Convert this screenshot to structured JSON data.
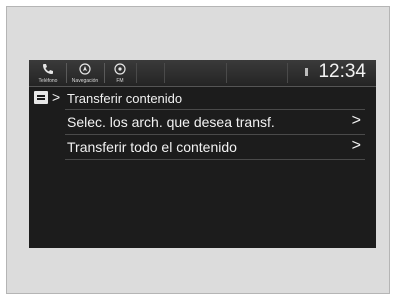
{
  "topbar": {
    "tabs": [
      {
        "label": "Teléfono",
        "icon": "phone-icon"
      },
      {
        "label": "Navegación",
        "icon": "navigation-icon"
      },
      {
        "label": "FM",
        "icon": "radio-icon"
      }
    ],
    "clock": "12:34"
  },
  "breadcrumb": {
    "home_icon": "menu-home-icon",
    "title": "Transferir contenido"
  },
  "list": {
    "items": [
      {
        "label": "Selec. los arch. que desea transf.",
        "icon": "chevron-right-icon"
      },
      {
        "label": "Transferir todo el contenido",
        "icon": "chevron-right-icon"
      }
    ]
  },
  "colors": {
    "screen_bg": "#1c1c1c",
    "text": "#f2f2f2",
    "frame_bg": "#dcdcdc"
  }
}
